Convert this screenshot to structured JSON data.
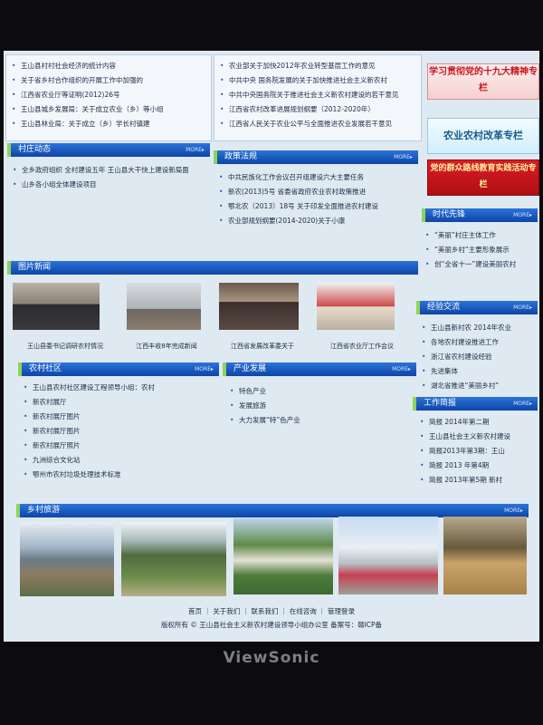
{
  "top_left_list": [
    "王山县村村社会经济的统计内容",
    "关于省乡村合作组织的开展工作中加强的",
    "江西省农业厅等证明(2012)26号",
    "王山县城乡发展局：关于成立农业（乡）等小组",
    "王山县林业局：关于成立（乡）学长村镇建"
  ],
  "top_mid_list": [
    "农业部关于加快2012年农业转型基层工作的意见",
    "中共中央 国务院发展的关于加快推进社会主义新农村",
    "中共中央国务院关于推进社会主义新农村建设的若干意见",
    "江西省农村改革进展规划纲要（2012-2020年）",
    "江西省人民关于农业公平与全面推进农业发展若干意见"
  ],
  "village_news": {
    "title": "村庄动态",
    "more": "MORE▸",
    "items": [
      "全乡政府组织 全村建设五年 王山县大干快上建设新局面",
      "山乡各小组全体建设项目"
    ]
  },
  "policy": {
    "title": "政策法规",
    "more": "MORE▸",
    "items": [
      "中共民族化工作会议召开组建设六大主要任务",
      "新农(2013)5号 省委省政府农业农村政策推进",
      "鄂北农（2013）18号 关于印发全面推进农村建设",
      "农业部规划纲要(2014-2020)关于小康"
    ]
  },
  "banners": {
    "study": "学习贯彻党的十九大精神专栏",
    "reform": "农业农村改革专栏",
    "mass_line": "党的群众路线教育实践活动专栏"
  },
  "pioneer": {
    "title": "时代先锋",
    "more": "MORE▸",
    "items": [
      "“美丽”村庄主体工作",
      "“美丽乡村”主要形象展示",
      "创“全省十一”建设美丽农村"
    ]
  },
  "photo_news": {
    "title": "图片新闻",
    "captions": [
      "王山县委书记调研农村情况",
      "江西丰收8年完成新闻",
      "江西省发展改革委关于",
      "江西省农业厅工作会议"
    ]
  },
  "experience": {
    "title": "经验交流",
    "more": "MORE▸",
    "items": [
      "王山县新村农 2014年农业",
      "各地农村建设推进工作",
      "浙江省农村建设经验",
      "先进集体",
      "湖北省推进“美丽乡村”"
    ]
  },
  "work_brief": {
    "title": "工作简报",
    "more": "MORE▸",
    "items": [
      "简报 2014年第二期",
      "王山县社会主义新农村建设",
      "简报2013年第3期：王山",
      "简报 2013 年第4期",
      "简报 2013年第5期 新村"
    ]
  },
  "community": {
    "title": "农村社区",
    "more": "MORE▸",
    "items": [
      "王山县农村社区建设工程领导小组：农村",
      "新农村展厅",
      "新农村展厅图片",
      "新农村展厅图片",
      "新农村展厅照片",
      "九洲综合文化站",
      "鄂州市农村垃圾处理技术标准"
    ]
  },
  "industry": {
    "title": "产业发展",
    "more": "MORE▸",
    "items": [
      "特色产业",
      "发展旅游",
      "大力发展“特”色产业"
    ]
  },
  "rural_tour": {
    "title": "乡村旅游",
    "more": "MORE▸"
  },
  "footer": {
    "links": "首页 ｜ 关于我们 ｜ 联系我们 ｜ 在线咨询 ｜ 管理登录",
    "copy": "版权所有 © 王山县社会主义新农村建设领导小组办公室   备案号：赣ICP备"
  },
  "monitor_brand": "ViewSonic"
}
